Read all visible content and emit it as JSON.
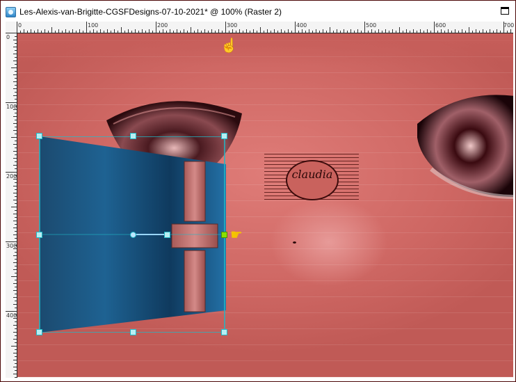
{
  "window": {
    "title": "Les-Alexis-van-Brigitte-CGSFDesigns-07-10-2021* @ 100% (Raster 2)"
  },
  "rulers": {
    "top_labels": [
      "0",
      "100",
      "200",
      "300",
      "400",
      "500",
      "600",
      "700"
    ],
    "left_labels": [
      "0",
      "100",
      "200",
      "300",
      "400"
    ]
  },
  "canvas": {
    "watermark_text": "claudia"
  },
  "colors": {
    "canvas_pink": "#d8726e",
    "panel_blue": "#1c5f8e",
    "selection_cyan": "#1fb9c7",
    "cursor_yellow": "#f5c400"
  },
  "icons": {
    "app": "psp-app-icon",
    "maximize": "maximize-icon",
    "cursor_top": "pointing-hand-up-icon",
    "cursor_right": "pointing-hand-right-icon",
    "rotate": "rotate-handle-icon"
  }
}
